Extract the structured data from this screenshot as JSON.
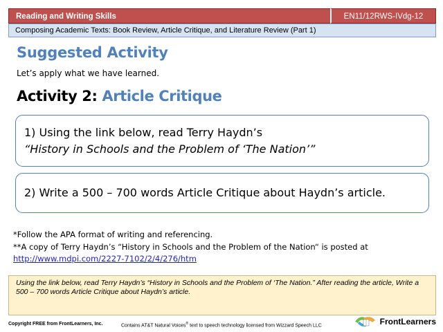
{
  "header": {
    "subject": "Reading and Writing Skills",
    "code": "EN11/12RWS-IVdg-12",
    "topic": "Composing Academic Texts: Book Review, Article Critique, and Literature Review (Part 1)"
  },
  "main": {
    "suggested_heading": "Suggested Activity",
    "intro": "Let’s apply what we have learned.",
    "activity_number": "Activity 2: ",
    "activity_name": "Article Critique",
    "step1_line1": "1) Using the link below, read Terry Haydn’s",
    "step1_line2": "“History in Schools and the Problem of ‘The Nation’”",
    "step2": "2) Write a 500 – 700 words Article Critique about Haydn’s article."
  },
  "notes": {
    "apa_note": "*Follow the APA format of writing and referencing.",
    "copy_note": "**A copy of Terry Haydn’s “History in Schools and the Problem of the Nation“ is posted at",
    "link": "http://www.mdpi.com/2227-7102/2/4/276/htm"
  },
  "narration": {
    "text": "Using the link below, read Terry Haydn’s “History in Schools and the Problem of ‘The Nation.” After reading the article, Write a 500 – 700 words Article Critique about Haydn’s article."
  },
  "footer": {
    "copyright": "Copyright FREE from FrontLearners, Inc.",
    "att_prefix": "Contains AT&T Natural Voices",
    "att_mark": "®",
    "att_suffix": " text to speech technology licensed from Wizzard Speech LLC",
    "brand": "FrontLearners"
  },
  "colors": {
    "header_bg": "#c0504d",
    "topic_bg": "#d6e3f3",
    "accent_blue": "#4f81bd",
    "narration_bg": "#fff2cc",
    "link": "#1f1fd8"
  }
}
